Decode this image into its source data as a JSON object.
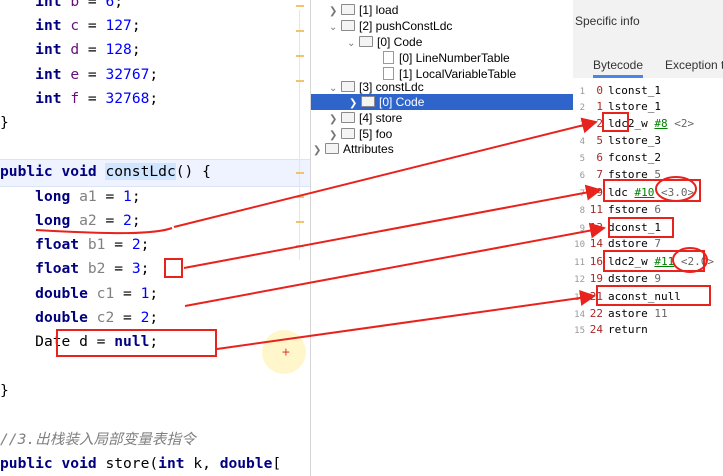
{
  "code_editor": {
    "lines": [
      {
        "ind": "    ",
        "kw": "int ",
        "var": "b",
        "rest": " = ",
        "num": "6",
        "end": ";"
      },
      {
        "ind": "    ",
        "kw": "int ",
        "var": "c",
        "rest": " = ",
        "num": "127",
        "end": ";"
      },
      {
        "ind": "    ",
        "kw": "int ",
        "var": "d",
        "rest": " = ",
        "num": "128",
        "end": ";"
      },
      {
        "ind": "    ",
        "kw": "int ",
        "var": "e",
        "rest": " = ",
        "num": "32767",
        "end": ";"
      },
      {
        "ind": "    ",
        "kw": "int ",
        "var": "f",
        "rest": " = ",
        "num": "32768",
        "end": ";"
      },
      {
        "text": "}"
      },
      {
        "method_kw": "public void ",
        "method_name": "constLdc",
        "method_rest": "() {"
      },
      {
        "ind": "    ",
        "kw": "long ",
        "var": "a1",
        "rest": " = ",
        "num": "1",
        "end": ";"
      },
      {
        "ind": "    ",
        "kw": "long ",
        "var": "a2",
        "rest": " = ",
        "num": "2",
        "end": ";"
      },
      {
        "ind": "    ",
        "kw": "float ",
        "var": "b1",
        "rest": " = ",
        "num": "2",
        "end": ";"
      },
      {
        "ind": "    ",
        "kw": "float ",
        "var": "b2",
        "rest": " = ",
        "num": "3",
        "end": ";"
      },
      {
        "ind": "    ",
        "kw": "double ",
        "var": "c1",
        "rest": " = ",
        "num": "1",
        "end": ";"
      },
      {
        "ind": "    ",
        "kw": "double ",
        "var": "c2",
        "rest": " = ",
        "num": "2",
        "end": ";"
      },
      {
        "ind": "    ",
        "kw2": "Date ",
        "var2": "d",
        "rest": " = ",
        "kw3": "null",
        "end": ";"
      },
      {
        "text": "}"
      },
      {
        "comment": "//3.出栈装入局部变量表指令"
      },
      {
        "method_kw": "public void ",
        "method_name": "store",
        "method_rest": "(",
        "p_kw": "int ",
        "p_var": "k",
        "p_sep": ", ",
        "p_kw2": "double",
        "p_end": "["
      }
    ]
  },
  "tree": {
    "items": [
      {
        "label": "[1] load"
      },
      {
        "label": "[2] pushConstLdc"
      },
      {
        "label": "[0] Code"
      },
      {
        "label": "[0] LineNumberTable"
      },
      {
        "label": "[1] LocalVariableTable"
      },
      {
        "label": "[3] constLdc"
      },
      {
        "label": "[0] Code"
      },
      {
        "label": "[4] store"
      },
      {
        "label": "[5] foo"
      },
      {
        "label": "Attributes"
      }
    ]
  },
  "info": {
    "title": "Specific info",
    "tabs": [
      "Bytecode",
      "Exception t"
    ]
  },
  "bytecode": [
    {
      "n": "1",
      "off": "0",
      "op": "lconst_1",
      "ref": "",
      "val": ""
    },
    {
      "n": "2",
      "off": "1",
      "op": "lstore_1",
      "ref": "",
      "val": ""
    },
    {
      "n": "3",
      "off": "2",
      "op": "ldc2_w ",
      "ref": "#8",
      "val": " <2>"
    },
    {
      "n": "4",
      "off": "5",
      "op": "lstore_3",
      "ref": "",
      "val": ""
    },
    {
      "n": "5",
      "off": "6",
      "op": "fconst_2",
      "ref": "",
      "val": ""
    },
    {
      "n": "6",
      "off": "7",
      "op": "fstore ",
      "ref": "",
      "val": "5"
    },
    {
      "n": "7",
      "off": "9",
      "op": "ldc ",
      "ref": "#10",
      "val": " <3.0>"
    },
    {
      "n": "8",
      "off": "11",
      "op": "fstore ",
      "ref": "",
      "val": "6"
    },
    {
      "n": "9",
      "off": "13",
      "op": "dconst_1",
      "ref": "",
      "val": ""
    },
    {
      "n": "10",
      "off": "14",
      "op": "dstore ",
      "ref": "",
      "val": "7"
    },
    {
      "n": "11",
      "off": "16",
      "op": "ldc2_w ",
      "ref": "#11",
      "val": " <2.0>"
    },
    {
      "n": "12",
      "off": "19",
      "op": "dstore ",
      "ref": "",
      "val": "9"
    },
    {
      "n": "13",
      "off": "21",
      "op": "aconst_null",
      "ref": "",
      "val": ""
    },
    {
      "n": "14",
      "off": "22",
      "op": "astore ",
      "ref": "",
      "val": "11"
    },
    {
      "n": "15",
      "off": "24",
      "op": "return",
      "ref": "",
      "val": ""
    }
  ]
}
